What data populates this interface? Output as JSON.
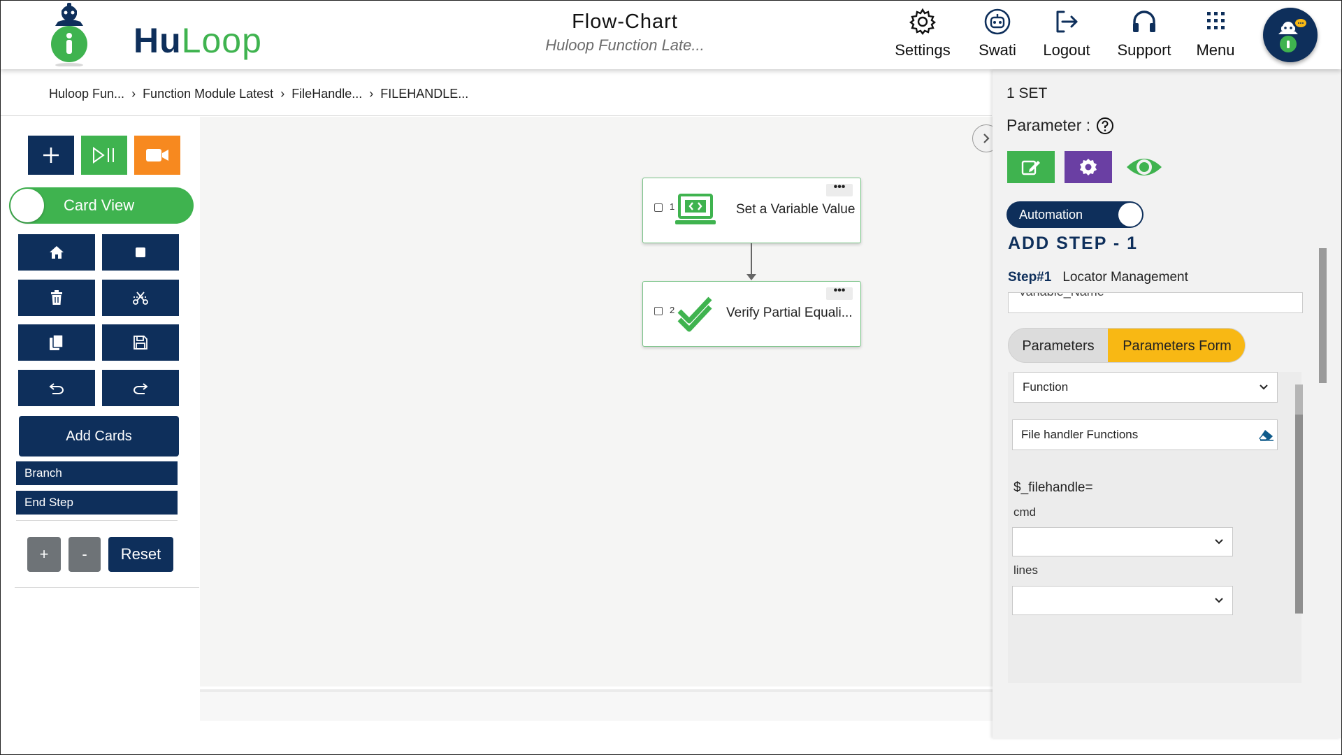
{
  "header": {
    "logo_hu": "Hu",
    "logo_loop": "Loop",
    "title": "Flow-Chart",
    "subtitle": "Huloop Function Late...",
    "nav": {
      "settings": "Settings",
      "user": "Swati",
      "logout": "Logout",
      "support": "Support",
      "menu": "Menu"
    }
  },
  "breadcrumb": [
    "Huloop Fun...",
    "Function Module Latest",
    "FileHandle...",
    "FILEHANDLE..."
  ],
  "left_panel": {
    "card_view": "Card View",
    "add_cards": "Add Cards",
    "branch": "Branch",
    "end_step": "End Step",
    "zoom_in": "+",
    "zoom_out": "-",
    "reset": "Reset"
  },
  "flow": {
    "cards": [
      {
        "num": "1",
        "label": "Set a Variable Value"
      },
      {
        "num": "2",
        "label": "Verify Partial Equali..."
      }
    ],
    "menu_dots": "•••"
  },
  "right_panel": {
    "set_label": "1 SET",
    "parameter_label": "Parameter :",
    "automation": "Automation",
    "add_step": "ADD STEP - 1",
    "step_num": "Step#1",
    "step_name": "Locator Management",
    "cut_input_value": "Variable_Name",
    "tabs": {
      "parameters": "Parameters",
      "parameters_form": "Parameters Form"
    },
    "form": {
      "function_select": "Function",
      "file_handler": "File handler Functions",
      "filehandle_expr": "$_filehandle=",
      "cmd_label": "cmd",
      "cmd_value": "",
      "lines_label": "lines",
      "lines_value": ""
    }
  },
  "colors": {
    "navy": "#0e2f5b",
    "green": "#3fb34f",
    "orange": "#f7891f",
    "purple": "#6a3fa3",
    "yellow": "#f8b814",
    "gray_btn": "#6e7377"
  }
}
